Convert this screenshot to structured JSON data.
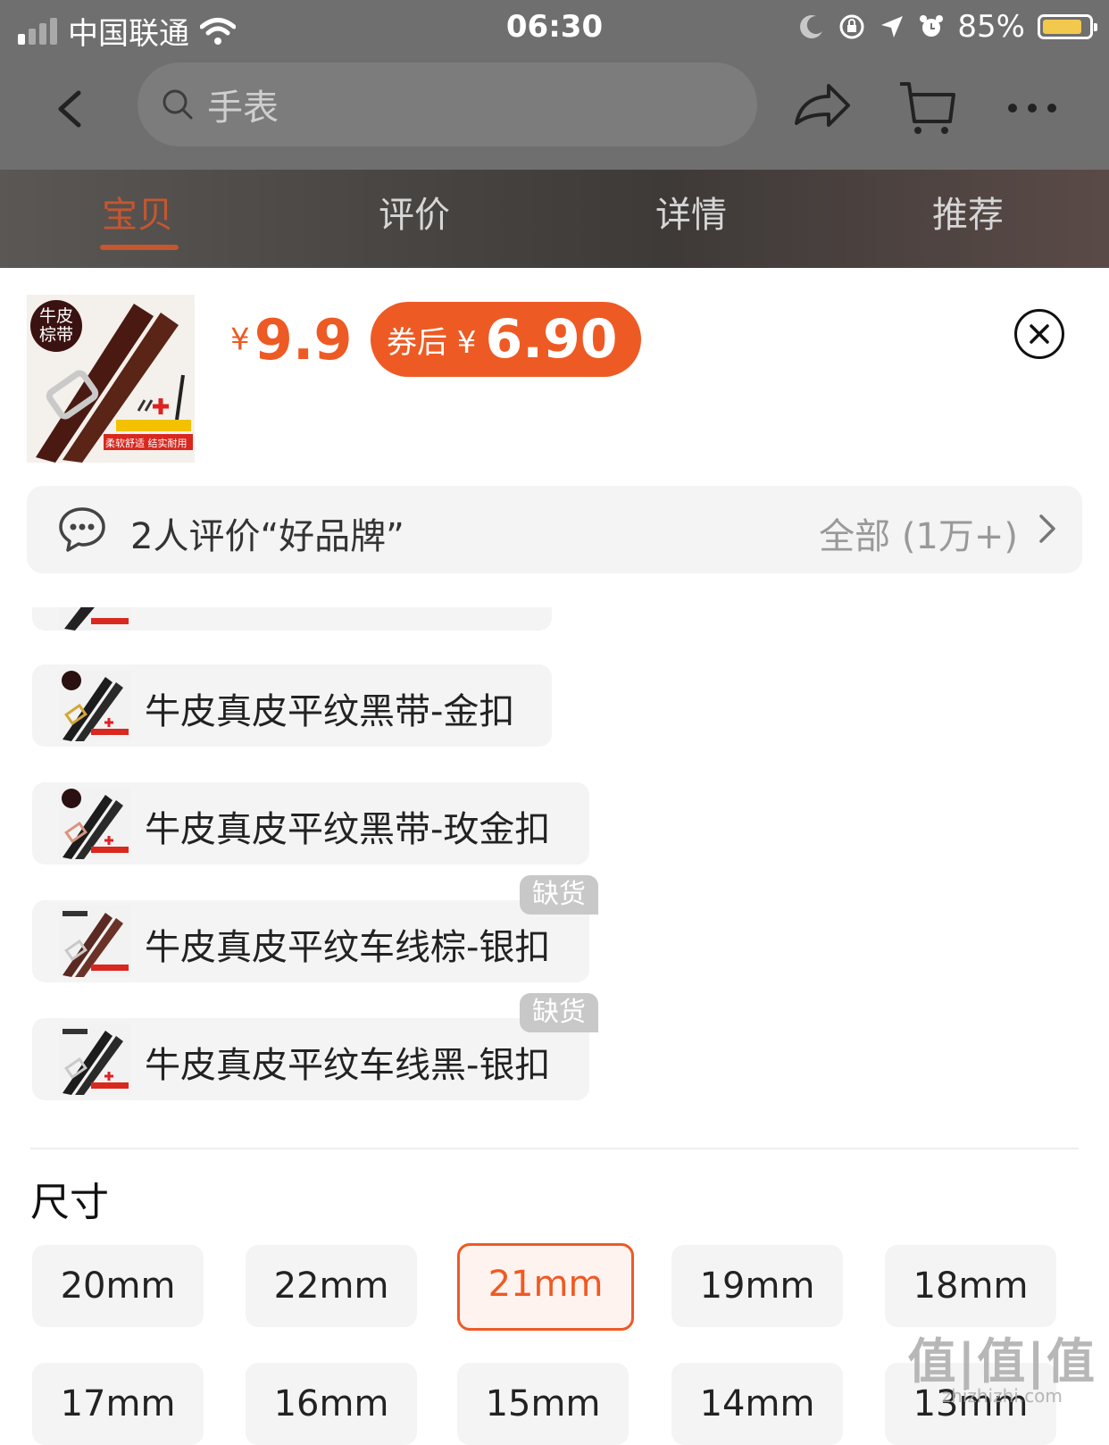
{
  "status_bar": {
    "carrier": "中国联通",
    "time": "06:30",
    "battery": "85%",
    "battery_level": 0.85
  },
  "nav": {
    "search_placeholder": "手表",
    "icons": [
      "chevron-left-icon",
      "search-icon",
      "share-icon",
      "cart-icon",
      "more-icon"
    ]
  },
  "tabs": [
    "宝贝",
    "评价",
    "详情",
    "推荐"
  ],
  "product": {
    "thumb_badge": "牛皮\n棕带",
    "thumb_caption": "柔软舒适 结实耐用",
    "price_currency": "¥",
    "price": "9.9",
    "coupon_label": "券后 ¥",
    "coupon_price": "6.90"
  },
  "review": {
    "text": "2人评价“好品牌”",
    "all": "全部 (1万+)"
  },
  "options": [
    {
      "label": "牛皮真皮平纹黑带-金扣",
      "out_of_stock": ""
    },
    {
      "label": "牛皮真皮平纹黑带-玫金扣",
      "out_of_stock": ""
    },
    {
      "label": "牛皮真皮平纹车线棕-银扣",
      "out_of_stock": "缺货"
    },
    {
      "label": "牛皮真皮平纹车线黑-银扣",
      "out_of_stock": "缺货"
    }
  ],
  "size_section": {
    "title": "尺寸",
    "sizes": [
      "20mm",
      "22mm",
      "21mm",
      "19mm",
      "18mm",
      "17mm",
      "16mm",
      "15mm",
      "14mm",
      "13mm"
    ],
    "selected": "21mm"
  },
  "watermark": {
    "logo": "值|值|值",
    "site": "zhizhizhi.com"
  },
  "colors": {
    "accent": "#ee5a24",
    "overlay": "#6f6f6f"
  }
}
